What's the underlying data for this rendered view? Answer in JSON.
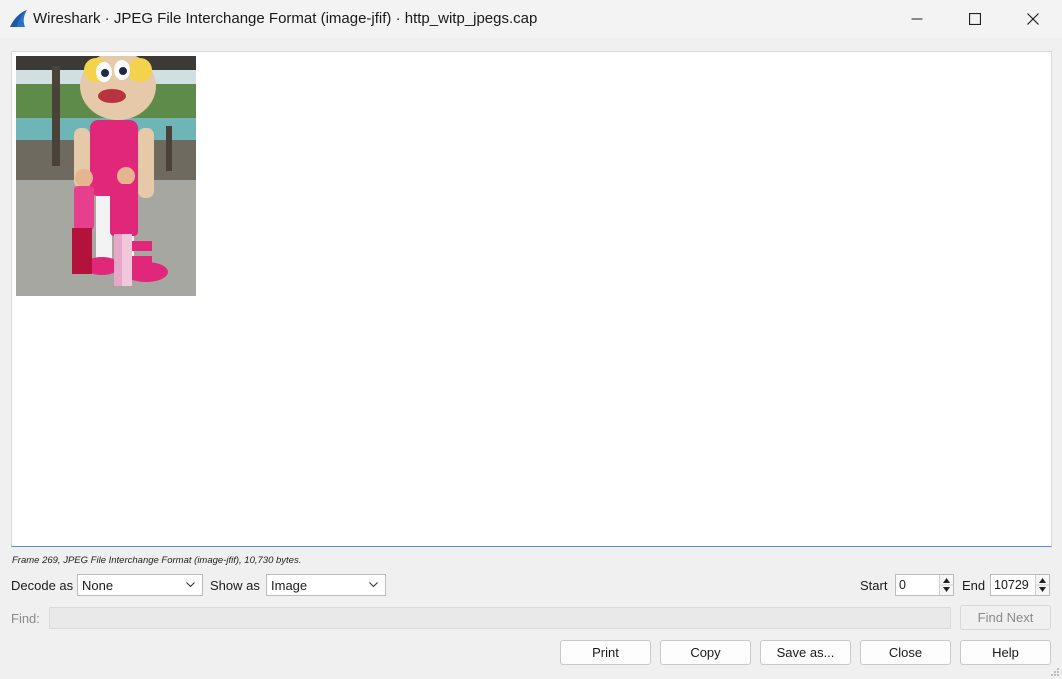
{
  "window": {
    "title": "Wireshark · JPEG File Interchange Format (image-jfif) · http_witp_jpegs.cap"
  },
  "status": {
    "frame_info": "Frame 269, JPEG File Interchange Format (image-jfif), 10,730 bytes."
  },
  "controls": {
    "decode_as_label": "Decode as",
    "decode_as_value": "None",
    "show_as_label": "Show as",
    "show_as_value": "Image",
    "start_label": "Start",
    "start_value": "0",
    "end_label": "End",
    "end_value": "10729",
    "find_label": "Find:",
    "find_next_label": "Find Next"
  },
  "buttons": {
    "print": "Print",
    "copy": "Copy",
    "save_as": "Save as...",
    "close": "Close",
    "help": "Help"
  },
  "colors": {
    "accent": "#5b8fc7",
    "shark_fin": "#2a6fc9"
  },
  "icons": {
    "app": "wireshark-fin-icon",
    "minimize": "minimize-icon",
    "maximize": "maximize-icon",
    "close": "close-icon"
  }
}
